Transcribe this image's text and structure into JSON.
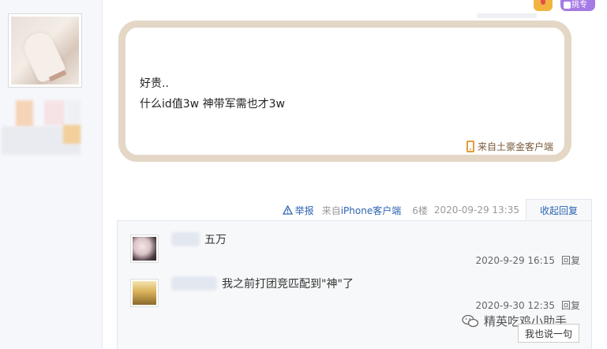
{
  "post": {
    "lines": [
      "好贵..",
      "什么id值3w 神带军需也才3w"
    ],
    "source": "来自土豪金客户端"
  },
  "top_badges": {
    "pick_label": "挑专"
  },
  "meta": {
    "report": "举报",
    "from_prefix": "来自",
    "device": "iPhone客户端",
    "floor": "6楼",
    "time": "2020-09-29 13:35",
    "collapse": "收起回复"
  },
  "replies": [
    {
      "text": "五万",
      "time": "2020-9-29 16:15",
      "reply": "回复"
    },
    {
      "text": "我之前打团竞匹配到\"神\"了",
      "time": "2020-9-30 12:35",
      "reply": "回复"
    }
  ],
  "say_button": "我也说一句",
  "watermark": "精英吃鸡小助手",
  "colors": {
    "card_border": "#e4d7c6",
    "link_blue": "#2d64b3",
    "phone_orange": "#e49a3b"
  }
}
